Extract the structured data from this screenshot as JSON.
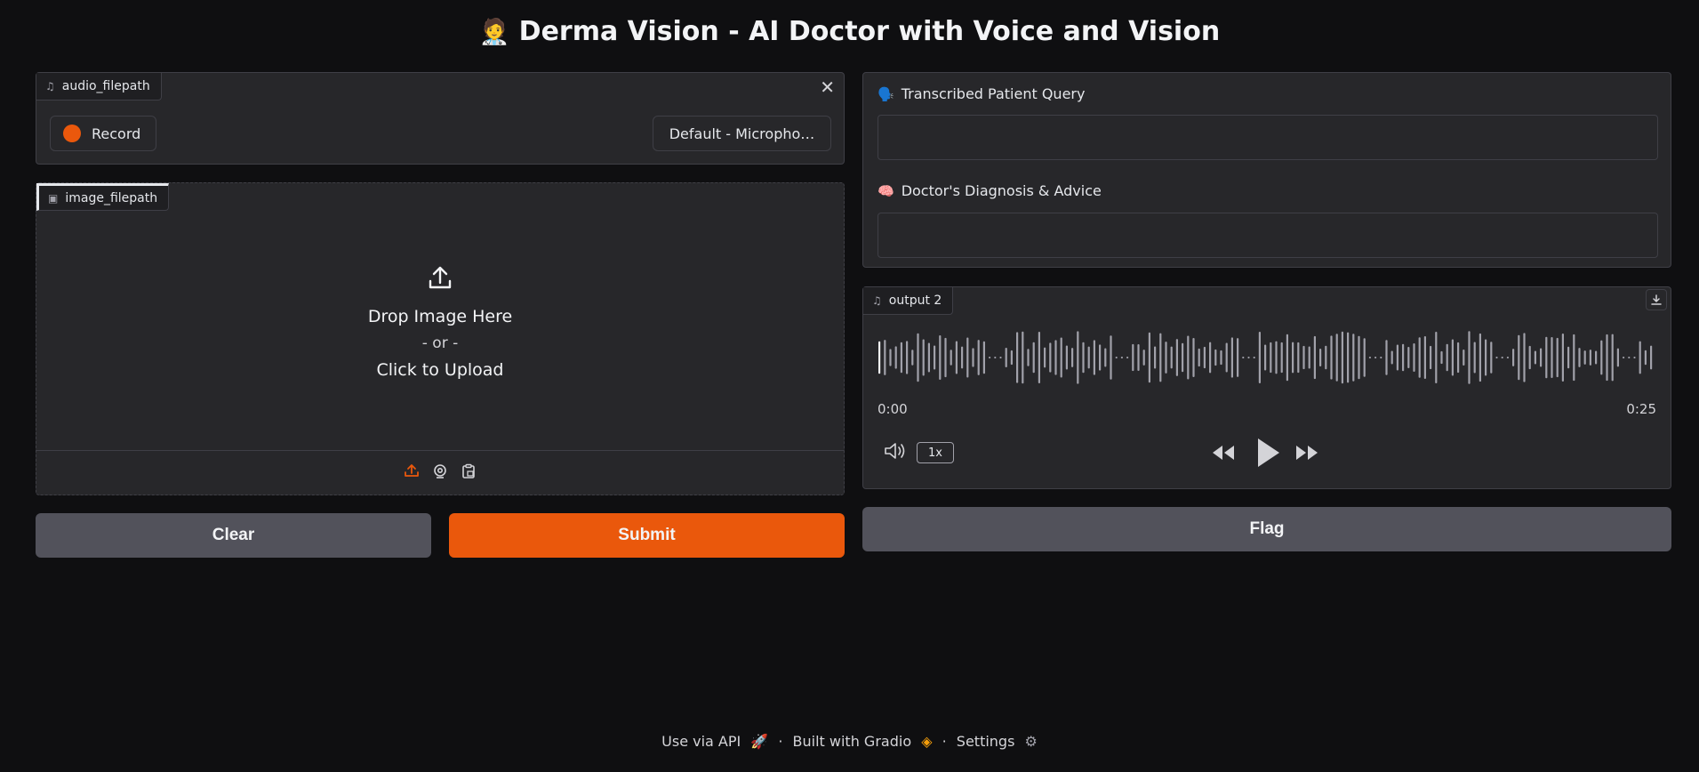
{
  "header": {
    "emoji": "🧑‍⚕️",
    "title": "Derma Vision - AI Doctor with Voice and Vision"
  },
  "audio_input": {
    "label": "audio_filepath",
    "record_label": "Record",
    "device_selected": "Default - Micropho…"
  },
  "image_input": {
    "label": "image_filepath",
    "drop_text": "Drop Image Here",
    "or_text": "- or -",
    "click_text": "Click to Upload"
  },
  "buttons": {
    "clear": "Clear",
    "submit": "Submit",
    "flag": "Flag"
  },
  "outputs": {
    "transcribed_label": "Transcribed Patient Query",
    "transcribed_emoji": "🗣️",
    "transcribed_value": "",
    "diagnosis_label": "Doctor's Diagnosis & Advice",
    "diagnosis_emoji": "🧠",
    "diagnosis_value": ""
  },
  "audio_output": {
    "label": "output 2",
    "time_current": "0:00",
    "time_total": "0:25",
    "speed": "1x"
  },
  "footer": {
    "api": "Use via API",
    "built": "Built with Gradio",
    "settings": "Settings",
    "dot": "·"
  },
  "colors": {
    "accent": "#ea580c",
    "bg": "#0f0f11",
    "panel": "#27272a"
  }
}
